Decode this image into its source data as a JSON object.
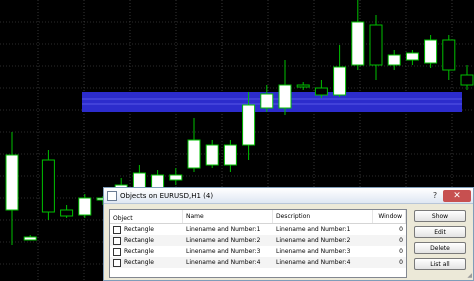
{
  "chart": {
    "background": "#000000",
    "up_color": "#ffffff",
    "down_color": "#000000",
    "wick_color": "#00c000",
    "highlight_color": "#2c2ccc",
    "candles": [
      {
        "o": 210,
        "c": 155,
        "h": 132,
        "l": 245
      },
      {
        "o": 240,
        "c": 237,
        "h": 235,
        "l": 240
      },
      {
        "o": 160,
        "c": 212,
        "h": 150,
        "l": 220
      },
      {
        "o": 210,
        "c": 216,
        "h": 205,
        "l": 218
      },
      {
        "o": 215,
        "c": 198,
        "h": 194,
        "l": 218
      },
      {
        "o": 200,
        "c": 198,
        "h": 196,
        "l": 205
      },
      {
        "o": 200,
        "c": 185,
        "h": 178,
        "l": 205
      },
      {
        "o": 195,
        "c": 173,
        "h": 165,
        "l": 198
      },
      {
        "o": 188,
        "c": 175,
        "h": 170,
        "l": 195
      },
      {
        "o": 180,
        "c": 175,
        "h": 168,
        "l": 185
      },
      {
        "o": 168,
        "c": 140,
        "h": 118,
        "l": 172
      },
      {
        "o": 165,
        "c": 145,
        "h": 140,
        "l": 168
      },
      {
        "o": 165,
        "c": 145,
        "h": 140,
        "l": 172
      },
      {
        "o": 145,
        "c": 105,
        "h": 92,
        "l": 160
      },
      {
        "o": 108,
        "c": 94,
        "h": 85,
        "l": 112
      },
      {
        "o": 108,
        "c": 85,
        "h": 60,
        "l": 115
      },
      {
        "o": 85,
        "c": 87,
        "h": 82,
        "l": 90
      },
      {
        "o": 88,
        "c": 95,
        "h": 80,
        "l": 98
      },
      {
        "o": 95,
        "c": 67,
        "h": 45,
        "l": 97
      },
      {
        "o": 65,
        "c": 22,
        "h": 0,
        "l": 70
      },
      {
        "o": 25,
        "c": 65,
        "h": 15,
        "l": 80
      },
      {
        "o": 65,
        "c": 55,
        "h": 50,
        "l": 70
      },
      {
        "o": 60,
        "c": 53,
        "h": 50,
        "l": 65
      },
      {
        "o": 63,
        "c": 40,
        "h": 35,
        "l": 68
      },
      {
        "o": 40,
        "c": 70,
        "h": 35,
        "l": 80
      },
      {
        "o": 75,
        "c": 85,
        "h": 65,
        "l": 90
      }
    ]
  },
  "dialog": {
    "title": "Objects on EURUSD,H1 (4)",
    "help": "?",
    "close": "✕",
    "columns": [
      "Object",
      "Name",
      "Description",
      "Window"
    ],
    "rows": [
      {
        "object": "Rectangle",
        "name": "Linename and Number:1",
        "description": "Linename and Number:1",
        "window": "0"
      },
      {
        "object": "Rectangle",
        "name": "Linename and Number:2",
        "description": "Linename and Number:2",
        "window": "0"
      },
      {
        "object": "Rectangle",
        "name": "Linename and Number:3",
        "description": "Linename and Number:3",
        "window": "0"
      },
      {
        "object": "Rectangle",
        "name": "Linename and Number:4",
        "description": "Linename and Number:4",
        "window": "0"
      }
    ],
    "buttons": {
      "show": "Show",
      "edit": "Edit",
      "delete": "Delete",
      "list_all": "List all"
    }
  }
}
